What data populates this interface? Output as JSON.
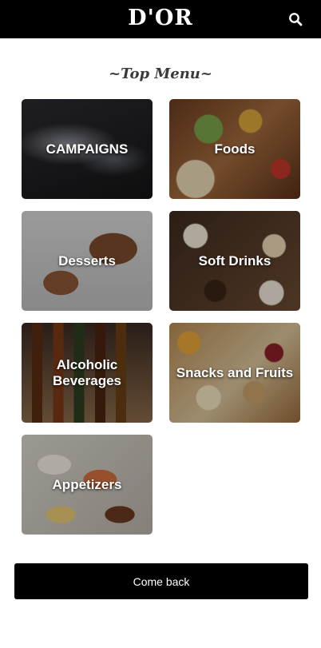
{
  "header": {
    "brand": "D'OR",
    "search_icon": "search-icon",
    "background_color": "#000000"
  },
  "menu": {
    "title": "~Top Menu~",
    "categories": [
      {
        "label": "CAMPAIGNS"
      },
      {
        "label": "Foods"
      },
      {
        "label": "Desserts"
      },
      {
        "label": "Soft Drinks"
      },
      {
        "label": "Alcoholic Beverages"
      },
      {
        "label": "Snacks and Fruits"
      },
      {
        "label": "Appetizers"
      }
    ]
  },
  "footer": {
    "back_label": "Come back"
  }
}
